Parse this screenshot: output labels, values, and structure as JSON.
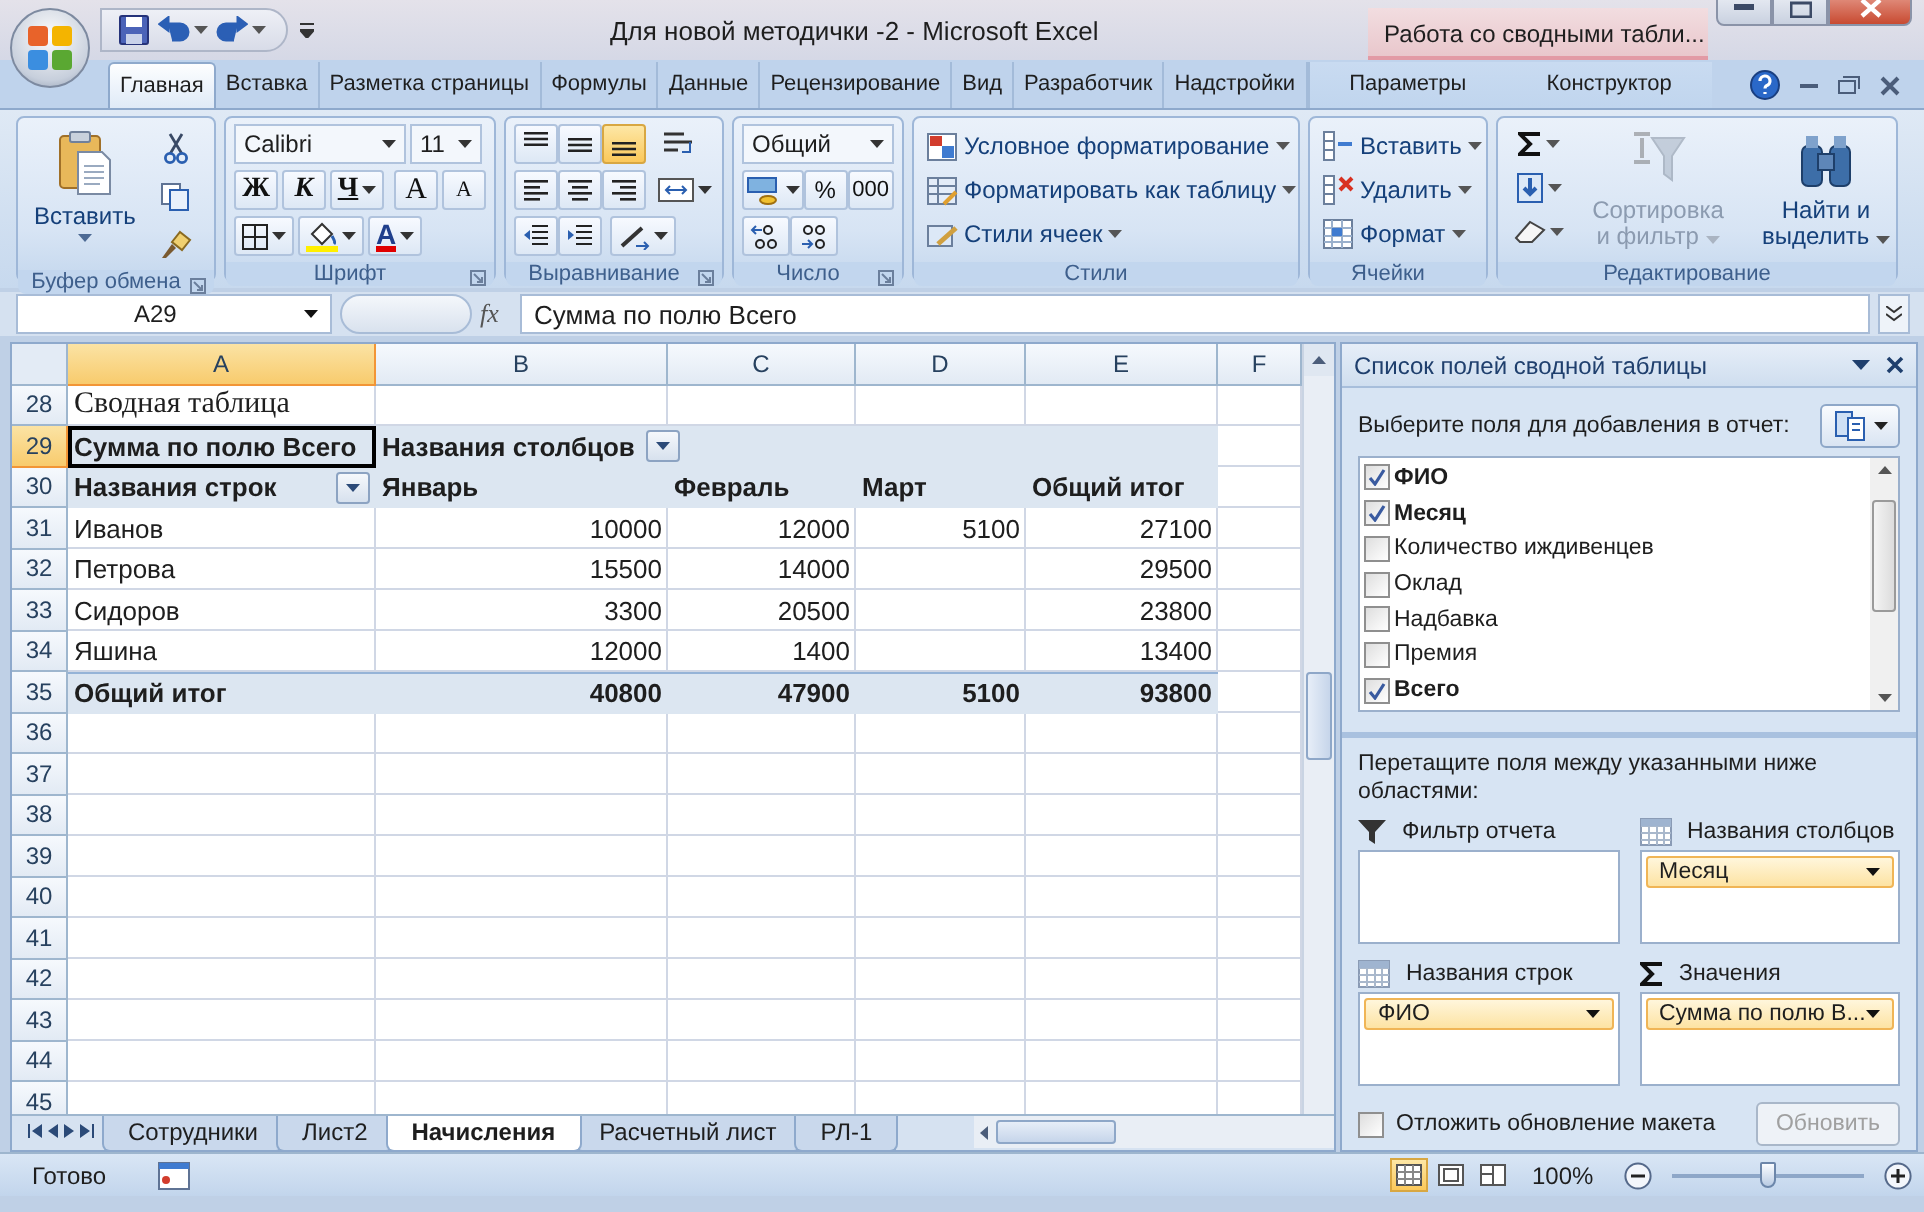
{
  "window": {
    "title": "Для новой методички -2 - Microsoft Excel",
    "context_label": "Работа со сводными табли..."
  },
  "ribbon_tabs": [
    {
      "label": "Главная",
      "selected": true,
      "kind": "normal"
    },
    {
      "label": "Вставка",
      "selected": false,
      "kind": "normal"
    },
    {
      "label": "Разметка страницы",
      "selected": false,
      "kind": "normal"
    },
    {
      "label": "Формулы",
      "selected": false,
      "kind": "normal"
    },
    {
      "label": "Данные",
      "selected": false,
      "kind": "normal"
    },
    {
      "label": "Рецензирование",
      "selected": false,
      "kind": "normal"
    },
    {
      "label": "Вид",
      "selected": false,
      "kind": "normal"
    },
    {
      "label": "Разработчик",
      "selected": false,
      "kind": "normal"
    },
    {
      "label": "Надстройки",
      "selected": false,
      "kind": "normal"
    },
    {
      "label": "Параметры",
      "selected": false,
      "kind": "contextual"
    },
    {
      "label": "Конструктор",
      "selected": false,
      "kind": "contextual"
    }
  ],
  "ribbon": {
    "clipboard": {
      "label": "Буфер обмена",
      "paste": "Вставить"
    },
    "font": {
      "label": "Шрифт",
      "font_name": "Calibri",
      "font_size": "11",
      "style_buttons": [
        "Ж",
        "К",
        "Ч"
      ],
      "size_buttons": [
        "A",
        "A"
      ],
      "color_letter": "A"
    },
    "alignment": {
      "label": "Выравнивание",
      "vertical_buttons": [
        {
          "selected": false
        },
        {
          "selected": false
        },
        {
          "selected": true
        }
      ]
    },
    "number": {
      "label": "Число",
      "format": "Общий",
      "percent": "%",
      "thousands": "000"
    },
    "styles": {
      "label": "Стили",
      "commands": [
        "Условное форматирование",
        "Форматировать как таблицу",
        "Стили ячеек"
      ]
    },
    "cells": {
      "label": "Ячейки",
      "commands": [
        "Вставить",
        "Удалить",
        "Формат"
      ]
    },
    "editing": {
      "label": "Редактирование",
      "sort": {
        "label": "Сортировка и фильтр",
        "disabled": true
      },
      "find": "Найти и выделить"
    }
  },
  "formula_bar": {
    "name_box": "A29",
    "function_label": "fx",
    "formula": "Сумма по полю Всего"
  },
  "sheet": {
    "columns": [
      {
        "label": "A",
        "selected": true
      },
      {
        "label": "B",
        "selected": false
      },
      {
        "label": "C",
        "selected": false
      },
      {
        "label": "D",
        "selected": false
      },
      {
        "label": "E",
        "selected": false
      },
      {
        "label": "F",
        "selected": false
      }
    ],
    "rows": [
      {
        "number": "28",
        "kind": "title",
        "selected": false,
        "cells": [
          "Сводная таблица",
          null,
          null,
          null,
          null,
          null
        ]
      },
      {
        "number": "29",
        "kind": "header",
        "selected": true,
        "cells": [
          {
            "text": "Сумма по полю Всего",
            "active": true
          },
          {
            "text": "Названия столбцов",
            "dropdown": true
          },
          null,
          null,
          null,
          null
        ]
      },
      {
        "number": "30",
        "kind": "header",
        "selected": false,
        "cells": [
          {
            "text": "Названия строк",
            "dropdown": true
          },
          "Январь",
          "Февраль",
          "Март",
          "Общий итог",
          null
        ]
      },
      {
        "number": "31",
        "kind": "data",
        "selected": false,
        "cells": [
          "Иванов",
          "10000",
          "12000",
          "5100",
          "27100",
          null
        ]
      },
      {
        "number": "32",
        "kind": "data",
        "selected": false,
        "cells": [
          "Петрова",
          "15500",
          "14000",
          null,
          "29500",
          null
        ]
      },
      {
        "number": "33",
        "kind": "data",
        "selected": false,
        "cells": [
          "Сидоров",
          "3300",
          "20500",
          null,
          "23800",
          null
        ]
      },
      {
        "number": "34",
        "kind": "data",
        "selected": false,
        "cells": [
          "Яшина",
          "12000",
          "1400",
          null,
          "13400",
          null
        ]
      },
      {
        "number": "35",
        "kind": "total",
        "selected": false,
        "cells": [
          "Общий итог",
          "40800",
          "47900",
          "5100",
          "93800",
          null
        ]
      },
      {
        "number": "36",
        "kind": "empty",
        "selected": false
      },
      {
        "number": "37",
        "kind": "empty",
        "selected": false
      },
      {
        "number": "38",
        "kind": "empty",
        "selected": false
      },
      {
        "number": "39",
        "kind": "empty",
        "selected": false
      },
      {
        "number": "40",
        "kind": "empty",
        "selected": false
      },
      {
        "number": "41",
        "kind": "empty",
        "selected": false
      },
      {
        "number": "42",
        "kind": "empty",
        "selected": false
      },
      {
        "number": "43",
        "kind": "empty",
        "selected": false
      },
      {
        "number": "44",
        "kind": "empty",
        "selected": false
      },
      {
        "number": "45",
        "kind": "empty",
        "selected": false
      }
    ],
    "tabs": [
      {
        "label": "Сотрудники",
        "selected": false
      },
      {
        "label": "Лист2",
        "selected": false
      },
      {
        "label": "Начисления",
        "selected": true
      },
      {
        "label": "Расчетный лист",
        "selected": false
      },
      {
        "label": "РЛ-1",
        "selected": false
      }
    ]
  },
  "pivot_pane": {
    "title": "Список полей сводной таблицы",
    "prompt": "Выберите поля для добавления в отчет:",
    "fields": [
      {
        "label": "ФИО",
        "checked": true
      },
      {
        "label": "Месяц",
        "checked": true
      },
      {
        "label": "Количество иждивенцев",
        "checked": false
      },
      {
        "label": "Оклад",
        "checked": false
      },
      {
        "label": "Надбавка",
        "checked": false
      },
      {
        "label": "Премия",
        "checked": false
      },
      {
        "label": "Всего",
        "checked": true
      }
    ],
    "drag_hint": "Перетащите поля между указанными ниже областями:",
    "areas": [
      {
        "kind": "filter",
        "label": "Фильтр отчета"
      },
      {
        "kind": "columns",
        "label": "Названия столбцов",
        "items": [
          "Месяц"
        ]
      },
      {
        "kind": "rows",
        "label": "Названия строк",
        "items": [
          "ФИО"
        ]
      },
      {
        "kind": "values",
        "label": "Значения",
        "items": [
          "Сумма по полю В..."
        ]
      }
    ],
    "defer": {
      "label": "Отложить обновление макета",
      "checked": false
    },
    "update_button": {
      "label": "Обновить",
      "disabled": true
    }
  },
  "status_bar": {
    "text": "Готово",
    "views": [
      {
        "selected": true
      },
      {
        "selected": false
      },
      {
        "selected": false
      }
    ],
    "zoom": "100%",
    "zoom_slider": {
      "level": 0.5
    }
  }
}
